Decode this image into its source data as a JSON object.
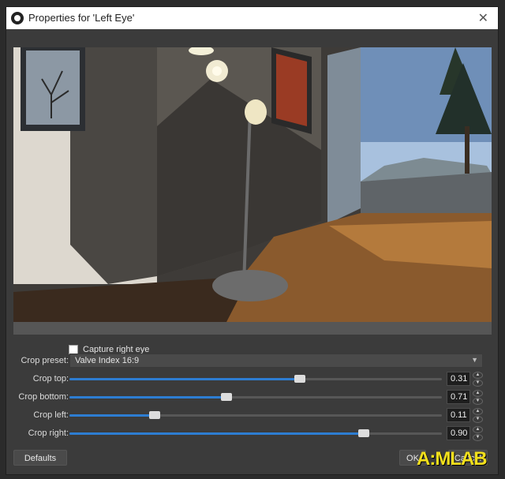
{
  "window": {
    "title": "Properties for 'Left Eye'"
  },
  "options": {
    "capture_right_eye": {
      "label": "Capture right eye",
      "checked": false
    }
  },
  "crop_preset": {
    "label": "Crop preset:",
    "value": "Valve Index 16:9"
  },
  "crops": [
    {
      "label": "Crop top:",
      "value": "0.31",
      "fill": 0.62
    },
    {
      "label": "Crop bottom:",
      "value": "0.71",
      "fill": 0.42
    },
    {
      "label": "Crop left:",
      "value": "0.11",
      "fill": 0.23
    },
    {
      "label": "Crop right:",
      "value": "0.90",
      "fill": 0.79
    }
  ],
  "buttons": {
    "defaults": "Defaults",
    "ok": "OK",
    "cancel": "Cancel"
  },
  "watermark": "A:MLAB",
  "colors": {
    "accent": "#2d7dd2",
    "watermark": "#f1df1c"
  }
}
